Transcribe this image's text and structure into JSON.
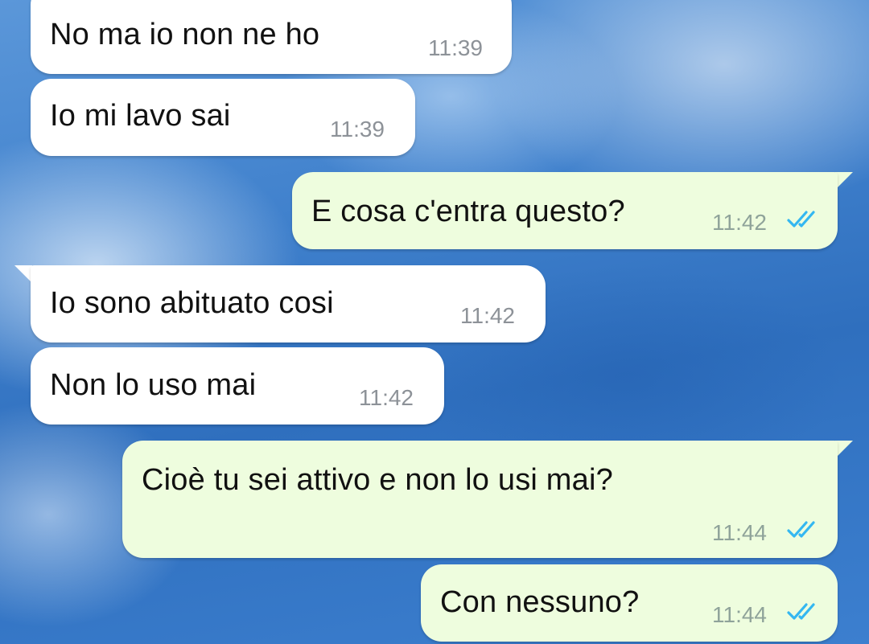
{
  "messages": [
    {
      "text": "No ma io non ne ho",
      "time": "11:39",
      "direction": "incoming"
    },
    {
      "text": "Io mi lavo sai",
      "time": "11:39",
      "direction": "incoming"
    },
    {
      "text": "E cosa c'entra questo?",
      "time": "11:42",
      "direction": "outgoing",
      "status": "read"
    },
    {
      "text": "Io sono abituato cosi",
      "time": "11:42",
      "direction": "incoming"
    },
    {
      "text": "Non lo uso mai",
      "time": "11:42",
      "direction": "incoming"
    },
    {
      "text": "Cioè tu sei attivo e non lo usi mai?",
      "time": "11:44",
      "direction": "outgoing",
      "status": "read"
    },
    {
      "text": "Con nessuno?",
      "time": "11:44",
      "direction": "outgoing",
      "status": "read"
    }
  ],
  "colors": {
    "incoming_bubble": "#ffffff",
    "outgoing_bubble": "#eefdde",
    "read_ticks": "#34b7f1"
  },
  "icons": {
    "read_status": "double-check-icon"
  }
}
